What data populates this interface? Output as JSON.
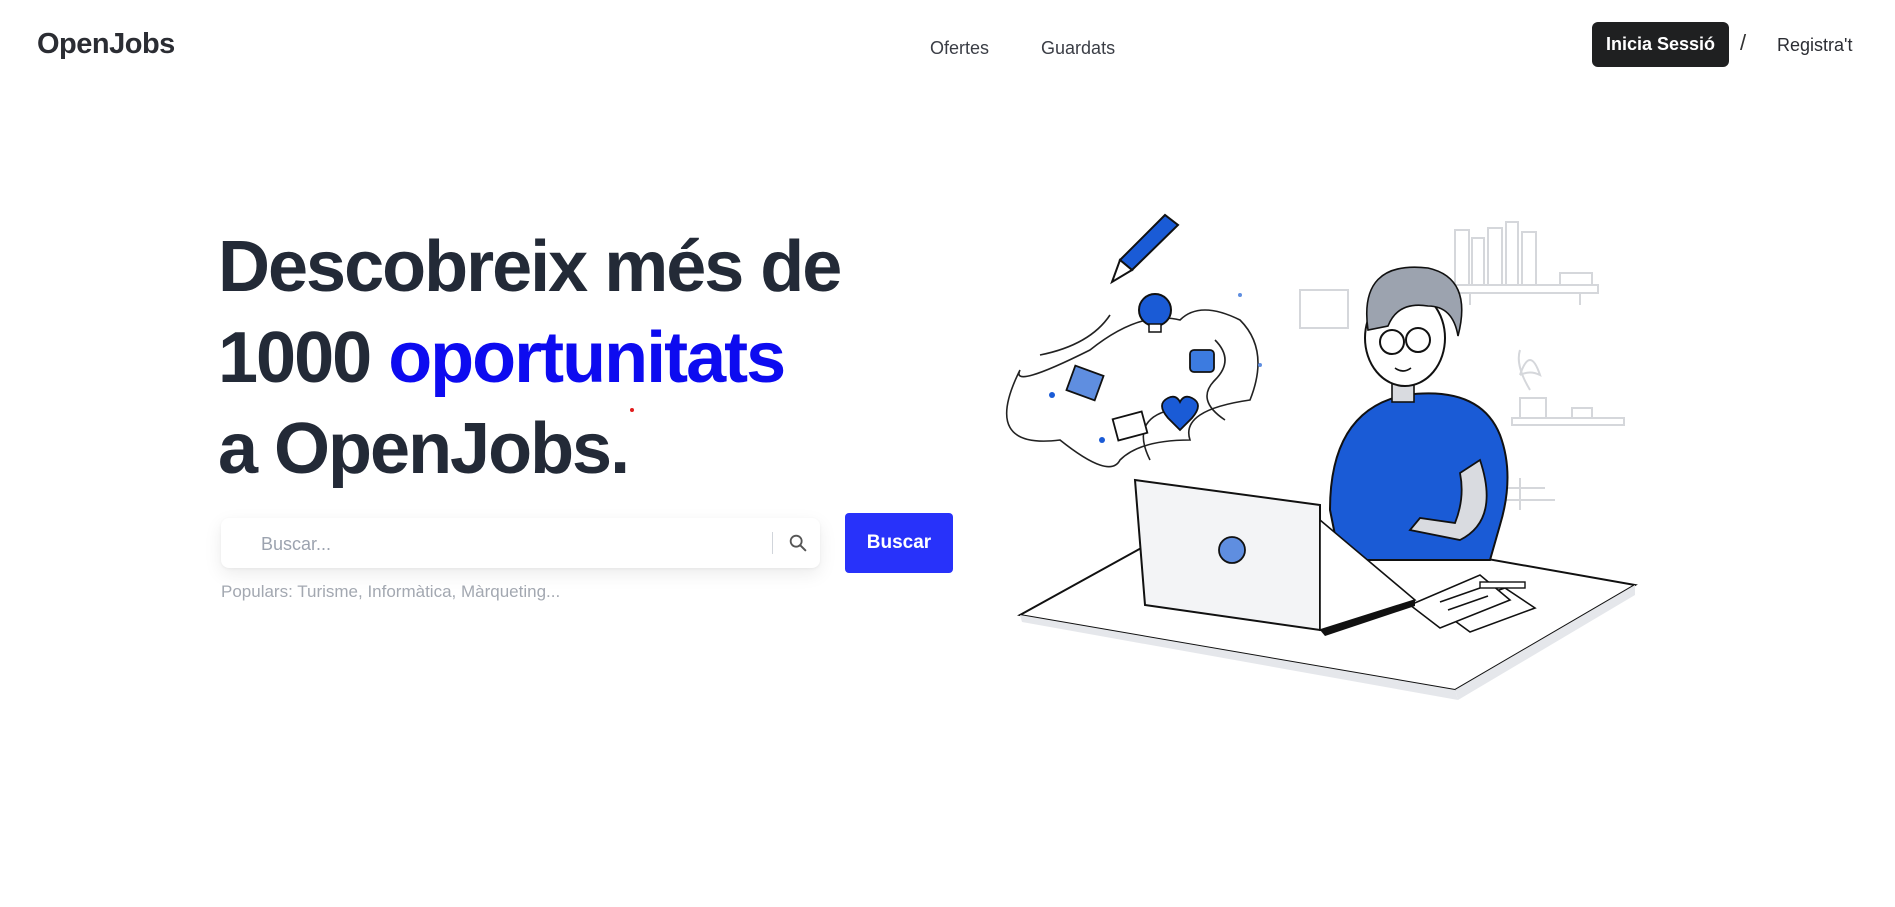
{
  "header": {
    "logo": "OpenJobs",
    "nav": [
      {
        "label": "Ofertes"
      },
      {
        "label": "Guardats"
      }
    ],
    "login_label": "Inicia Sessió",
    "separator": "/",
    "register_label": "Registra't"
  },
  "hero": {
    "title_line1": "Descobreix més de",
    "title_line2_prefix": "1000 ",
    "title_line2_accent": "oportunitats",
    "title_line3": "a OpenJobs.",
    "accent_color": "#0d0bf0"
  },
  "search": {
    "placeholder": "Buscar...",
    "value": "",
    "button_label": "Buscar",
    "popular_text": "Populars: Turisme, Informàtica, Màrqueting...",
    "icon": "search-icon"
  },
  "colors": {
    "brand": "#2832fa",
    "dark": "#1f2021",
    "illustration_blue": "#1a5bd6"
  }
}
